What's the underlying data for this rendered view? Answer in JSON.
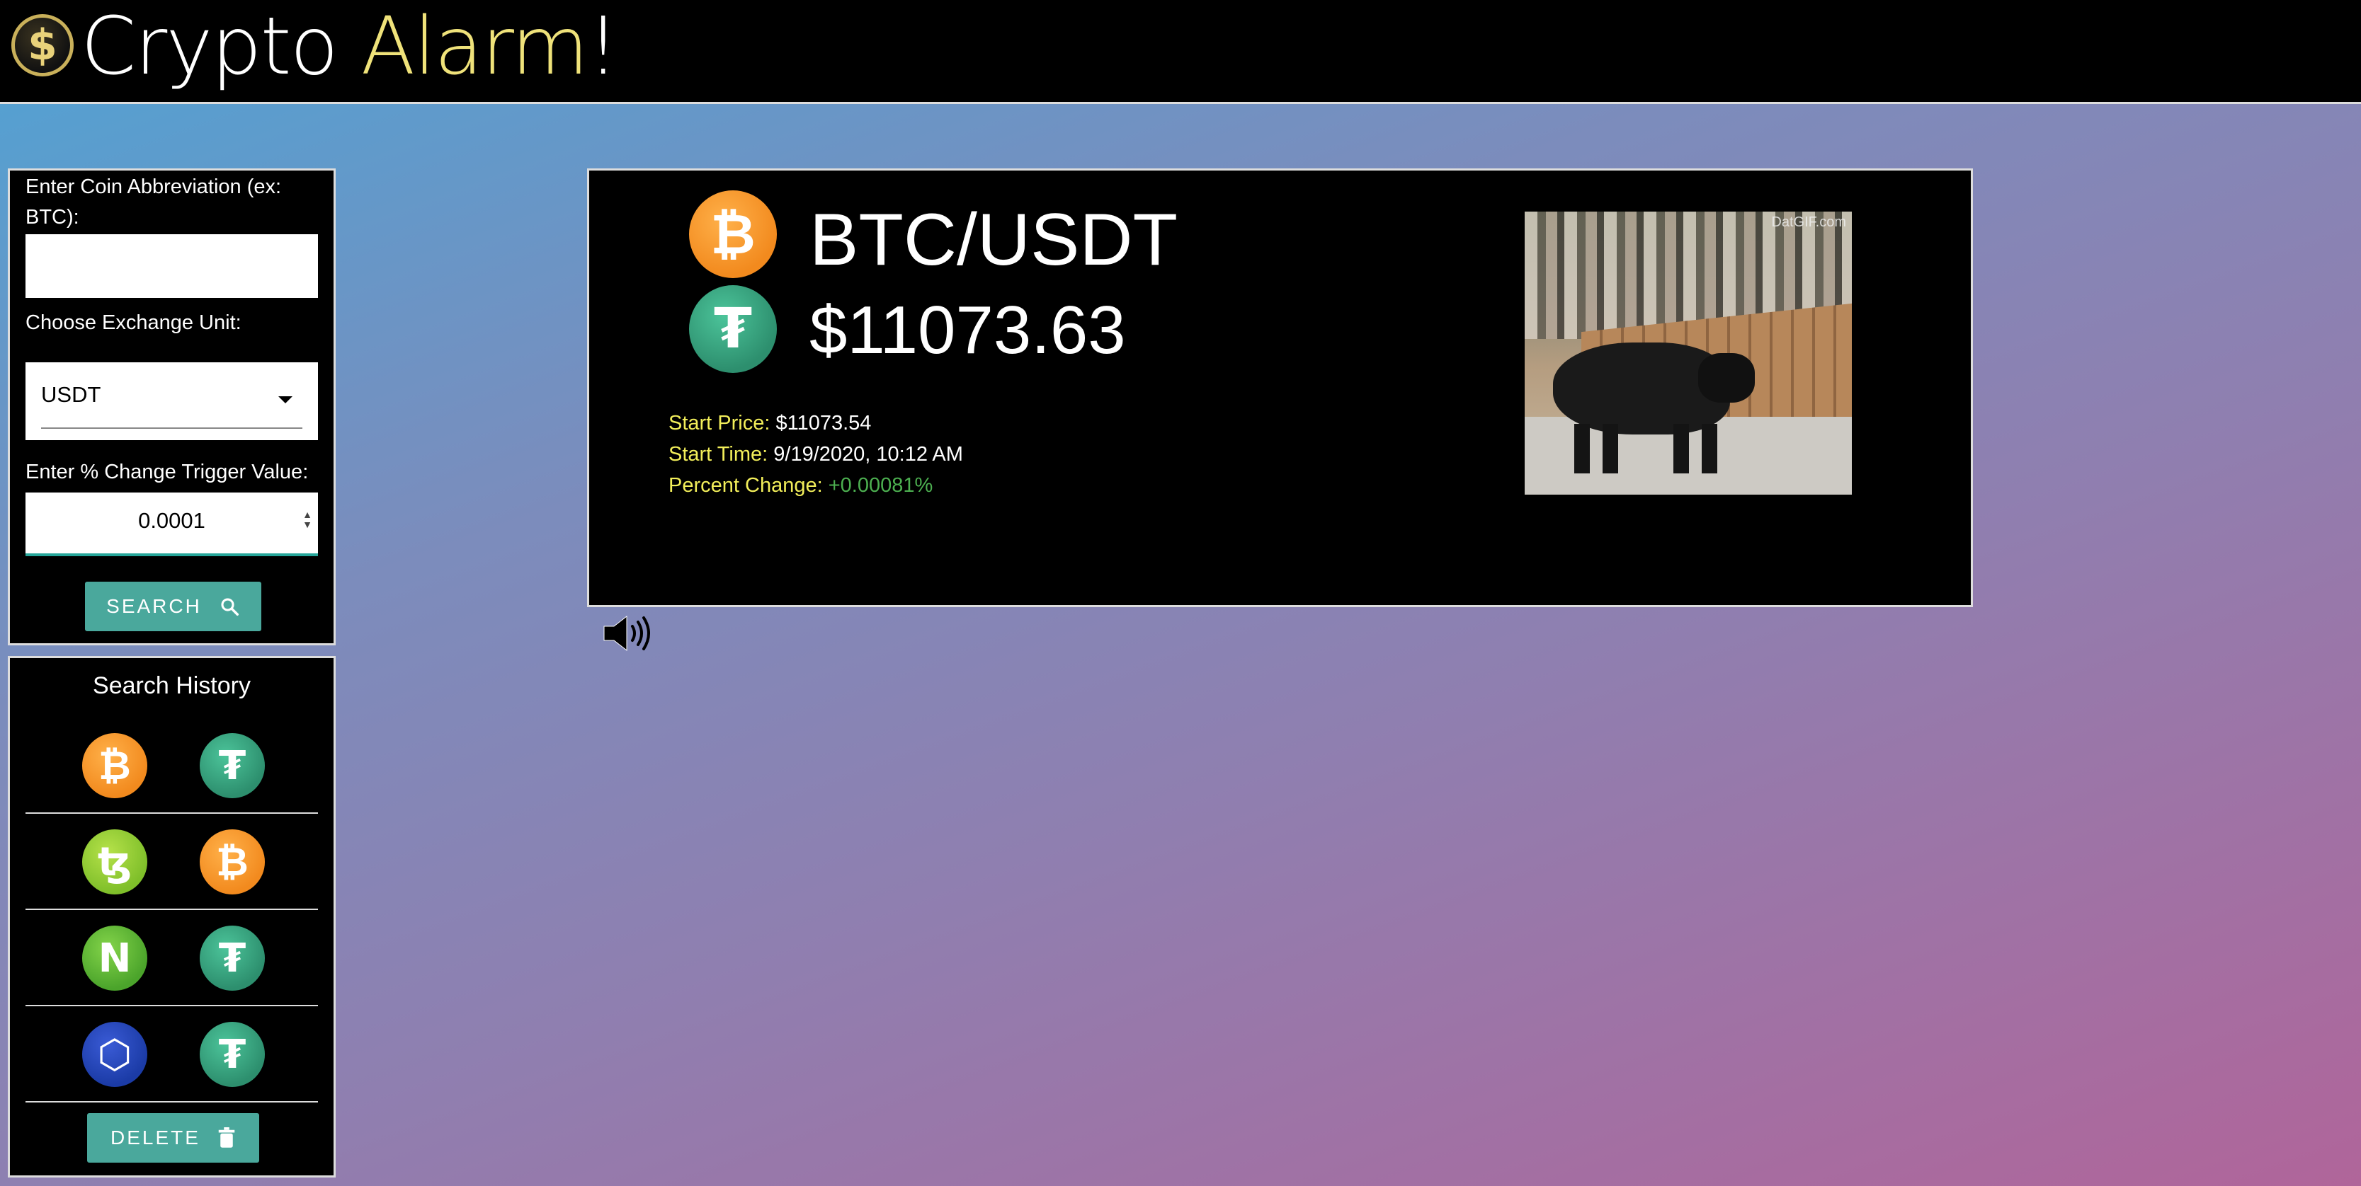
{
  "header": {
    "logo_symbol": "$",
    "title_part1": "Crypto ",
    "title_part2": "Alarm",
    "title_part3": "!",
    "accent_color": "#efe27a"
  },
  "form": {
    "coin_label": "Enter Coin Abbreviation (ex: BTC):",
    "coin_value": "",
    "exchange_label": "Choose Exchange Unit:",
    "exchange_selected": "USDT",
    "trigger_label": "Enter % Change Trigger Value:",
    "trigger_value": "0.0001",
    "search_label": "SEARCH",
    "search_icon": "magnifier-icon",
    "button_color": "#4aa89c"
  },
  "history": {
    "title": "Search History",
    "rows": [
      {
        "coin": "BTC",
        "coin_glyph": "₿",
        "unit": "USDT",
        "unit_glyph": "₮"
      },
      {
        "coin": "XTZ",
        "coin_glyph": "ꜩ",
        "unit": "BTC",
        "unit_glyph": "₿"
      },
      {
        "coin": "NEO",
        "coin_glyph": "N",
        "unit": "USDT",
        "unit_glyph": "₮"
      },
      {
        "coin": "LINK",
        "coin_glyph": "⬡",
        "unit": "USDT",
        "unit_glyph": "₮"
      }
    ],
    "delete_label": "DELETE",
    "delete_icon": "trash-icon"
  },
  "ticker": {
    "base_glyph": "₿",
    "quote_glyph": "₮",
    "pair": "BTC/USDT",
    "price": "$11073.63",
    "start_price_label": "Start Price:",
    "start_price": "$11073.54",
    "start_time_label": "Start Time:",
    "start_time": "9/19/2020, 10:12 AM",
    "percent_change_label": "Percent Change:",
    "percent_change": "+0.00081%",
    "change_color": "#4caf50",
    "gif_watermark": "DatGIF.com",
    "sound_icon": "speaker-icon"
  }
}
